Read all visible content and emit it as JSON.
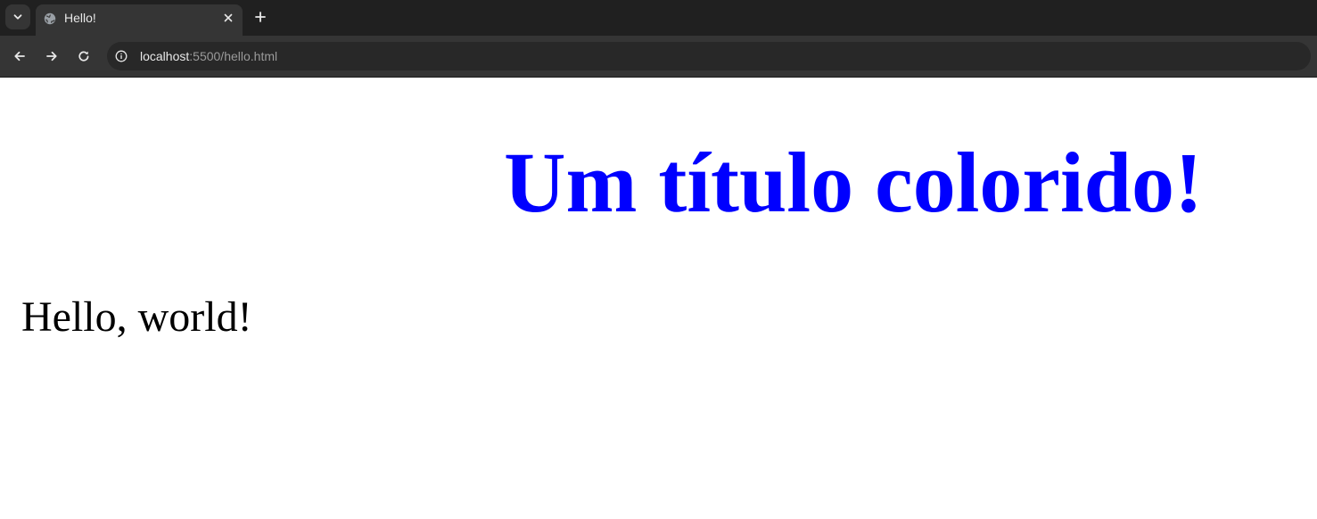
{
  "browser": {
    "tab": {
      "title": "Hello!",
      "favicon_icon": "globe-icon",
      "close_icon": "close-icon"
    },
    "tab_search_icon": "chevron-down-icon",
    "new_tab_icon": "plus-icon",
    "toolbar": {
      "back_icon": "arrow-left-icon",
      "forward_icon": "arrow-right-icon",
      "reload_icon": "reload-icon",
      "site_info_icon": "info-icon"
    },
    "address": {
      "host": "localhost",
      "rest": ":5500/hello.html"
    }
  },
  "page": {
    "heading": "Um título colorido!",
    "paragraph": "Hello, world!"
  },
  "colors": {
    "heading": "#0000ff",
    "text": "#000000",
    "background": "#ffffff"
  }
}
